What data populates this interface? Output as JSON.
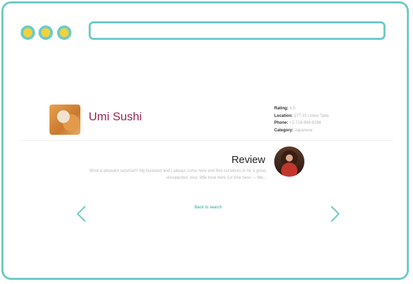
{
  "window": {
    "frame_color": "#6fcac6",
    "dot_color": "#f2d23c"
  },
  "restaurant": {
    "name": "Umi Sushi",
    "name_color": "#9b2457",
    "image_icon": "food-photo"
  },
  "details": {
    "rating_label": "Rating:",
    "rating_value": "4.5",
    "location_label": "Location:",
    "location_value": "177-15 Union Tpke",
    "phone_label": "Phone:",
    "phone_value": "+1-718-969-8298",
    "category_label": "Category:",
    "category_value": "Japanese"
  },
  "review": {
    "heading": "Review",
    "line1": "What a pleasant surprise!!! My husband and I always come here and find ourselves in for a great,",
    "line2": "unexpected, nice, little treat here 1st time here --- We...",
    "avatar_icon": "reviewer-avatar"
  },
  "nav": {
    "back_label": "Back to search",
    "prev_icon": "chevron-left-icon",
    "next_icon": "chevron-right-icon",
    "accent": "#2b9f9a"
  }
}
